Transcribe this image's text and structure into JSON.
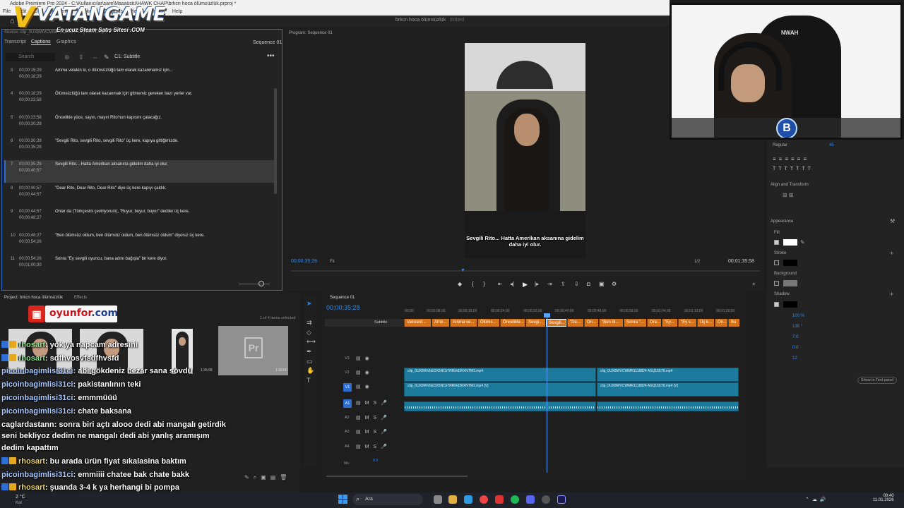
{
  "window": {
    "title": "Adobe Premiere Pro 2024 - C:\\Kullanıcılar\\sare\\Masaüstü\\HAWK CHAP\\brkcn hoca ölümsüzlük.prproj *",
    "menu": [
      "File",
      "Edit",
      "Clip",
      "Sequence",
      "Markers",
      "Graphics",
      "View",
      "Window",
      "Help"
    ],
    "project_title": "brkcn hoca ölümsüzlük",
    "edited": "Edited"
  },
  "logo": {
    "name": "VATANGAME",
    "tagline": "En ucuz Steam Satış Sitesi .COM"
  },
  "captions_panel": {
    "source": "Source: clip_0UX8WVCWMR1118824 ASQ15578.mp4",
    "tabs": [
      "Transcript",
      "Captions",
      "Graphics",
      "Effect Controls",
      "Text"
    ],
    "active_tab": "Captions",
    "sequence": "Sequence 01",
    "search_placeholder": "Search",
    "track": "C1: Subtitle",
    "rows": [
      {
        "num": "3",
        "in": "00;00;15;29",
        "out": "00;00;18;29",
        "text": "Amma velakin ki, o ölümsüzlüğü tam olarak kazanmamız için..."
      },
      {
        "num": "4",
        "in": "00;00;18;29",
        "out": "00;00;23;58",
        "text": "Ölümsüzlüğü tam olarak kazanmak için gitmemiz gereken bazı yerler var."
      },
      {
        "num": "5",
        "in": "00;00;23;58",
        "out": "00;00;30;28",
        "text": "Öncelikle yüce, sayın, mayın Rito'nun kapısını çalacağız."
      },
      {
        "num": "6",
        "in": "00;00;30;28",
        "out": "00;00;35;28",
        "text": "\"Sevgili Rito, sevgili Rito, sevgili Rito\" üç kere, kapıya gittiğimizde."
      },
      {
        "num": "7",
        "in": "00;00;35;28",
        "out": "00;00;40;57",
        "text": "Sevgili Rito... Hatta Amerikan aksanına gidelim daha iyi olur.",
        "selected": true
      },
      {
        "num": "8",
        "in": "00;00;40;57",
        "out": "00;00;44;57",
        "text": "\"Dear Rito, Dear Rito, Dear Rito\" diye üç kere kapıyı çaldık."
      },
      {
        "num": "9",
        "in": "00;00;44;57",
        "out": "00;00;48;27",
        "text": "Onlar da (Türkçesini çeviriyorum), \"Buyur, buyur, buyur\" dediler üç kere."
      },
      {
        "num": "10",
        "in": "00;00;48;27",
        "out": "00;00;54;26",
        "text": "\"Ben ölümsüz oldum, ben ölümsüz oldum, ben ölümsüz oldum\" diyoruz üç kere."
      },
      {
        "num": "11",
        "in": "00;00;54;26",
        "out": "00;01;00;30",
        "text": "Sonra \"Ey sevgili oyuncu, bana adını bağışla\" bir kere diyor."
      }
    ]
  },
  "program_monitor": {
    "label": "Program: Sequence 01",
    "subtitle": "Sevgili Rito... Hatta Amerikan aksanına gidelim daha iyi olur.",
    "timecode": "00;00;35;28",
    "fit": "Fit",
    "resolution": "1/2",
    "duration": "00;01;35;58"
  },
  "webcam": {
    "chair_text": "NWAH",
    "badge": "B"
  },
  "essential_graphics": {
    "font_style": "Regular",
    "font_size": "45",
    "align_transform": "Align and Transform",
    "appearance": "Appearance",
    "fill": "Fill",
    "stroke": "Stroke",
    "background": "Background",
    "shadow": "Shadow",
    "shadow_opacity": "100 %",
    "shadow_angle": "135 °",
    "shadow_distance": "7.0",
    "shadow_size": "0.0",
    "shadow_blur": "12",
    "show_in_text_panel": "Show in Text panel",
    "fill_color": "#ffffff",
    "stroke_color": "#000000",
    "shadow_color": "#000000"
  },
  "project_panel": {
    "tab": "Project: brkcn hoca ölümsüzlük",
    "effects_tab": "Effects",
    "items_selected": "1 of 4 items selected",
    "oyunfor_brand": "oyunfor",
    "oyunfor_tld": ".com",
    "thumb_duration_1": "1;35;58",
    "thumb_duration_2": "1:36:00",
    "pr_label": "Pr"
  },
  "chat": [
    {
      "user": "rhosart",
      "color": "g",
      "msg": ": yok ya napcam adresini",
      "badges": 2
    },
    {
      "user": "rhosart",
      "color": "g",
      "msg": ": sdfhvosvfsdfhvsfd",
      "badges": 2
    },
    {
      "user": "picoinbagimlisi31ci",
      "color": "b",
      "msg": ": abi gökdeniz bezar sana sövdü",
      "badges": 0
    },
    {
      "user": "picoinbagimlisi31ci",
      "color": "b",
      "msg": ": pakistanlının teki",
      "badges": 0
    },
    {
      "user": "picoinbagimlisi31ci",
      "color": "b",
      "msg": ": emmmüüü",
      "badges": 0
    },
    {
      "user": "picoinbagimlisi31ci",
      "color": "b",
      "msg": ": chate baksana",
      "badges": 0
    },
    {
      "user": "caglardastann",
      "color": "w",
      "msg": ": sonra biri açtı alooo dedi abi mangalı getirdik",
      "badges": 0
    },
    {
      "user": "",
      "color": "w",
      "msg": "seni bekliyoz dedim ne mangalı dedi abi yanlış aramışım",
      "badges": 0
    },
    {
      "user": "",
      "color": "w",
      "msg": "dedim kapattım",
      "badges": 0
    },
    {
      "user": "rhosart",
      "color": "y",
      "msg": ": bu arada ürün fiyat sıkalasina baktım",
      "badges": 2
    },
    {
      "user": "picoinbagimlisi31ci",
      "color": "b",
      "msg": ": emmiiii chatee bak chate bakk",
      "badges": 0
    },
    {
      "user": "rhosart",
      "color": "y",
      "msg": ": şuanda 3-4 k ya herhangi bi pompa",
      "badges": 2
    },
    {
      "user": "rhosart",
      "color": "y",
      "msg": ": alamazsın",
      "badges": 2
    }
  ],
  "timeline": {
    "tab": "Sequence 01",
    "timecode": "00;00;35;28",
    "ruler": [
      ":00;00",
      "00;00;08;00",
      "00;00;16;00",
      "00;00;24;00",
      "00;00;32;00",
      "00;00;40;00",
      "00;00;48;00",
      "00;00;56;00",
      "00;01;04;00",
      "00;01;12;00",
      "00;01;20;00"
    ],
    "caption_track": "Subtitle",
    "caption_clips": [
      "Valorant...",
      "Artık...",
      "Amma ve...",
      "Ölüms...",
      "Öncelikle...",
      "Sevgi...",
      "Sevgili...",
      "\"De...",
      "On...",
      "\"Ben öl...",
      "Sonra \"...",
      "Ora...",
      "\"Ey...",
      "\"Ey s...",
      "Üç k...",
      "On...",
      "Bu"
    ],
    "tracks_video": [
      "V3",
      "V2",
      "V1"
    ],
    "tracks_audio": [
      "A1",
      "A2",
      "A3",
      "A4"
    ],
    "clip_v2_a": "clip_0UX8WVbEDX5NCk7RRhkDRXNTM2.mp4",
    "clip_v2_b": "clip_0UX8WVCWMR1118824 ASQ15578.mp4",
    "clip_v1_a": "clip_0UX8WVbEDX5NCk7RRhkDRXNTM2.mp4 [V]",
    "clip_v1_b": "clip_0UX8WVCWMR1118824 ASQ15578.mp4 [V]",
    "mix": "Mix",
    "mix_value": "0.0"
  },
  "taskbar": {
    "weather": "2 °C",
    "weather_desc": "Kar",
    "search": "Ara",
    "time": "00:40",
    "date": "11.01.2026"
  }
}
